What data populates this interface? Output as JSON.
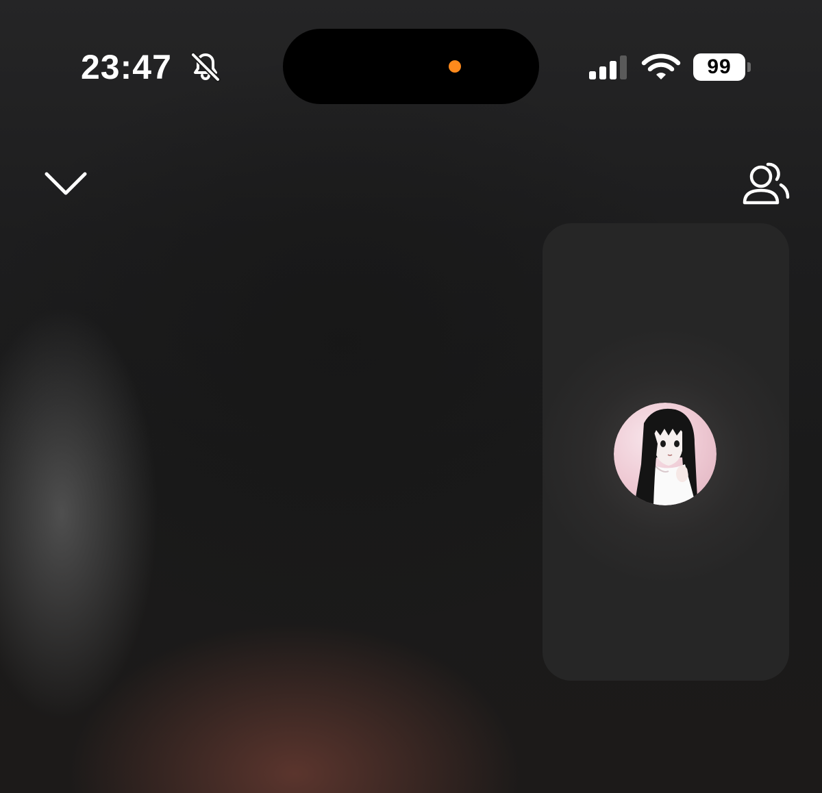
{
  "status_bar": {
    "time": "23:47",
    "silent_icon": "bell-slash-icon",
    "signal_icon": "cellular-signal-icon",
    "wifi_icon": "wifi-icon",
    "battery_level": "99",
    "indicator_color": "#ff8a1c"
  },
  "nav": {
    "collapse_icon": "chevron-down-icon",
    "participants_icon": "person-add-icon"
  },
  "self_view": {
    "avatar": "avatar-anime-girl"
  }
}
